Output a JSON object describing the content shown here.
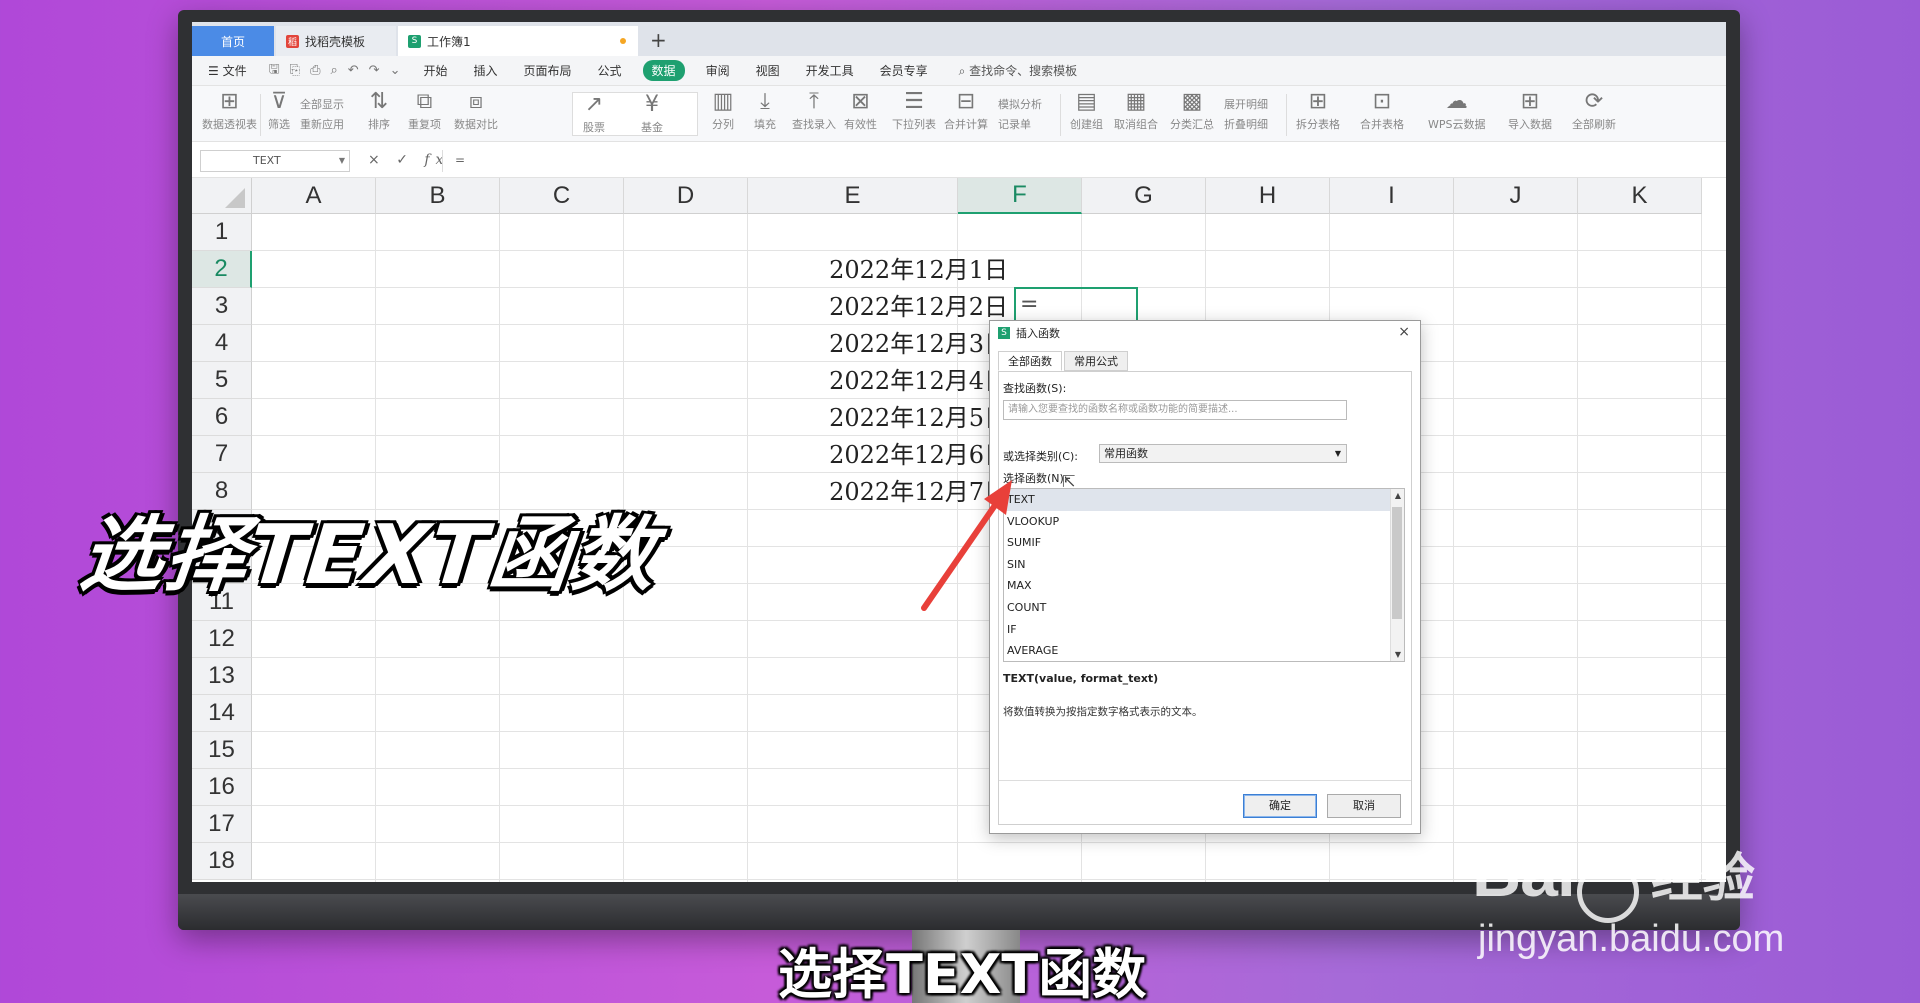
{
  "tabs": {
    "home": "首页",
    "templates": "找稻壳模板",
    "workbook": "工作簿1",
    "add": "+"
  },
  "menu": {
    "file": "文件",
    "items": [
      "开始",
      "插入",
      "页面布局",
      "公式",
      "数据",
      "审阅",
      "视图",
      "开发工具",
      "会员专享"
    ],
    "active": "数据",
    "search": "查找命令、搜索模板"
  },
  "ribbon": {
    "pivot": "数据透视表",
    "filter": "筛选",
    "show_all": "全部显示",
    "reapply": "重新应用",
    "sort": "排序",
    "dup": "重复项",
    "compare": "数据对比",
    "stock": "股票",
    "fund": "基金",
    "split": "分列",
    "fill": "填充",
    "lookup": "查找录入",
    "validity": "有效性",
    "dropdown": "下拉列表",
    "merge_calc": "合并计算",
    "simulate": "模拟分析",
    "record": "记录单",
    "group": "创建组",
    "ungroup": "取消组合",
    "subtotal": "分类汇总",
    "expand": "展开明细",
    "collapse": "折叠明细",
    "split_table": "拆分表格",
    "merge_table": "合并表格",
    "wps_cloud": "WPS云数据",
    "import": "导入数据",
    "refresh": "全部刷新"
  },
  "formula_bar": {
    "name_box": "TEXT",
    "cancel": "×",
    "confirm": "✓",
    "fx": "fx",
    "content": "="
  },
  "sheet": {
    "columns": [
      "A",
      "B",
      "C",
      "D",
      "E",
      "F",
      "G",
      "H",
      "I",
      "J",
      "K"
    ],
    "rows": [
      "1",
      "2",
      "3",
      "4",
      "5",
      "6",
      "7",
      "8",
      "9",
      "10",
      "11",
      "12",
      "13",
      "14",
      "15",
      "16",
      "17",
      "18"
    ],
    "selected_column": "F",
    "selected_row": "2",
    "dates": [
      "2022年12月1日",
      "2022年12月2日",
      "2022年12月3日",
      "2022年12月4日",
      "2022年12月5日",
      "2022年12月6日",
      "2022年12月7日"
    ],
    "active_cell_value": "="
  },
  "dialog": {
    "title": "插入函数",
    "close": "×",
    "tab_all": "全部函数",
    "tab_common": "常用公式",
    "search_label": "查找函数(S):",
    "search_placeholder": "请输入您要查找的函数名称或函数功能的简要描述...",
    "category_label": "或选择类别(C):",
    "category_value": "常用函数",
    "select_label": "选择函数(N):",
    "functions": [
      "TEXT",
      "VLOOKUP",
      "SUMIF",
      "SIN",
      "MAX",
      "COUNT",
      "IF",
      "AVERAGE"
    ],
    "selected_function": "TEXT",
    "signature": "TEXT(value, format_text)",
    "description": "将数值转换为按指定数字格式表示的文本。",
    "ok": "确定",
    "cancel": "取消"
  },
  "overlay": {
    "big_title": "选择TEXT函数",
    "subtitle": "选择TEXT函数",
    "watermark_brand": "Bai",
    "watermark_brand_tail": "经验",
    "watermark_url": "jingyan.baidu.com"
  },
  "colors": {
    "accent": "#1ea070",
    "arrow": "#e8403a",
    "background": "#b048d8"
  }
}
